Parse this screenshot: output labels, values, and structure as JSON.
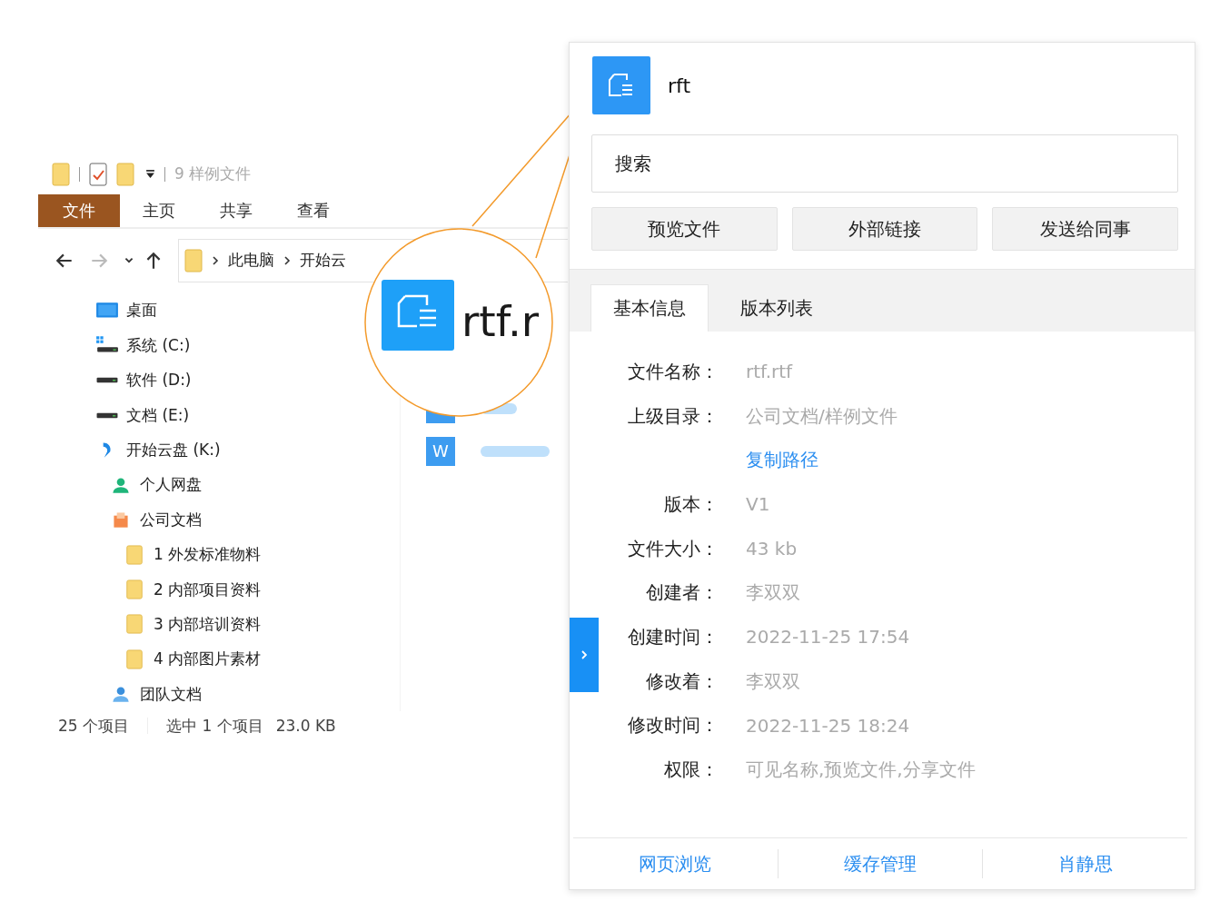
{
  "explorer": {
    "title": "9 样例文件",
    "ribbon_tabs": [
      {
        "label": "文件",
        "selected": true
      },
      {
        "label": "主页",
        "selected": false
      },
      {
        "label": "共享",
        "selected": false
      },
      {
        "label": "查看",
        "selected": false
      }
    ],
    "breadcrumb": [
      "此电脑",
      "开始云"
    ],
    "tree": [
      {
        "label": "桌面",
        "kind": "desktop"
      },
      {
        "label": "系统 (C:)",
        "kind": "system-drive"
      },
      {
        "label": "软件 (D:)",
        "kind": "drive"
      },
      {
        "label": "文档 (E:)",
        "kind": "drive"
      },
      {
        "label": "开始云盘 (K:)",
        "kind": "cloud",
        "children": [
          {
            "label": "个人网盘",
            "kind": "person"
          },
          {
            "label": "公司文档",
            "kind": "company",
            "children": [
              {
                "label": "1 外发标准物料",
                "kind": "folder"
              },
              {
                "label": "2 内部项目资料",
                "kind": "folder"
              },
              {
                "label": "3 内部培训资料",
                "kind": "folder"
              },
              {
                "label": "4 内部图片素材",
                "kind": "folder"
              }
            ]
          },
          {
            "label": "团队文档",
            "kind": "team"
          }
        ]
      }
    ],
    "files": [
      {
        "letter": "W"
      }
    ],
    "status_bar": {
      "count": "25 个项目",
      "selection": "选中 1 个项目",
      "size": "23.0 KB"
    }
  },
  "callout": {
    "text": "rtf.r"
  },
  "panel": {
    "file_name": "rft",
    "search": {
      "placeholder": "搜索"
    },
    "buttons": [
      "预览文件",
      "外部链接",
      "发送给同事"
    ],
    "tabs": [
      {
        "label": "基本信息",
        "selected": true
      },
      {
        "label": "版本列表",
        "selected": false
      }
    ],
    "info": [
      {
        "label": "文件名称：",
        "value": "rtf.rtf"
      },
      {
        "label": "上级目录：",
        "value": "公司文档/样例文件",
        "link": "复制路径"
      },
      {
        "label": "版本：",
        "value": "V1"
      },
      {
        "label": "文件大小：",
        "value": "43 kb"
      },
      {
        "label": "创建者：",
        "value": "李双双"
      },
      {
        "label": "创建时间：",
        "value": "2022-11-25 17:54"
      },
      {
        "label": "修改着：",
        "value": "李双双"
      },
      {
        "label": "修改时间：",
        "value": "2022-11-25 18:24"
      },
      {
        "label": "权限：",
        "value": "可见名称,预览文件,分享文件"
      }
    ],
    "footer_links": [
      "网页浏览",
      "缓存管理",
      "肖静思"
    ]
  }
}
